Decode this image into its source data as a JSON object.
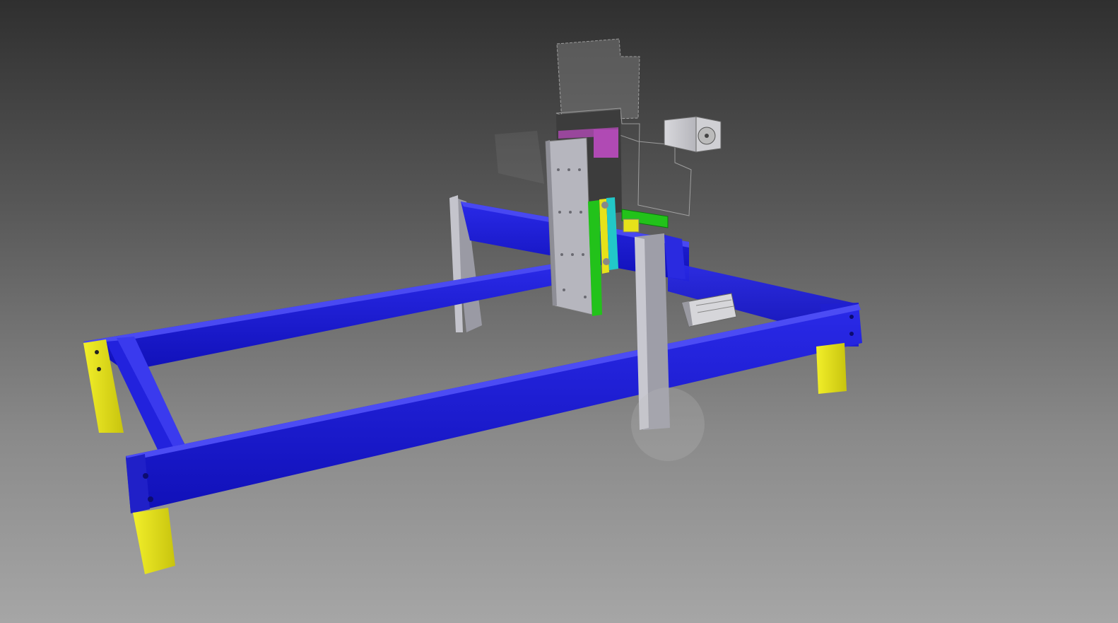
{
  "viewport": {
    "kind": "3d-cad-model-view",
    "background": {
      "top": "#2f2f2f",
      "bottom": "#a6a6a6"
    }
  },
  "model": {
    "parts": [
      {
        "name": "base-frame",
        "color": "#2525e0"
      },
      {
        "name": "frame-legs",
        "color": "#e6e21a"
      },
      {
        "name": "gantry-uprights",
        "color": "#9a9aa8"
      },
      {
        "name": "z-carriage-plate",
        "color": "#b4b4bc"
      },
      {
        "name": "stepper-motor",
        "color": "#c8c8cc"
      },
      {
        "name": "linear-rail-green",
        "color": "#22c21a"
      },
      {
        "name": "carriage-cyan",
        "color": "#22c8c8"
      },
      {
        "name": "bracket-magenta",
        "color": "#b04ab4"
      }
    ]
  }
}
